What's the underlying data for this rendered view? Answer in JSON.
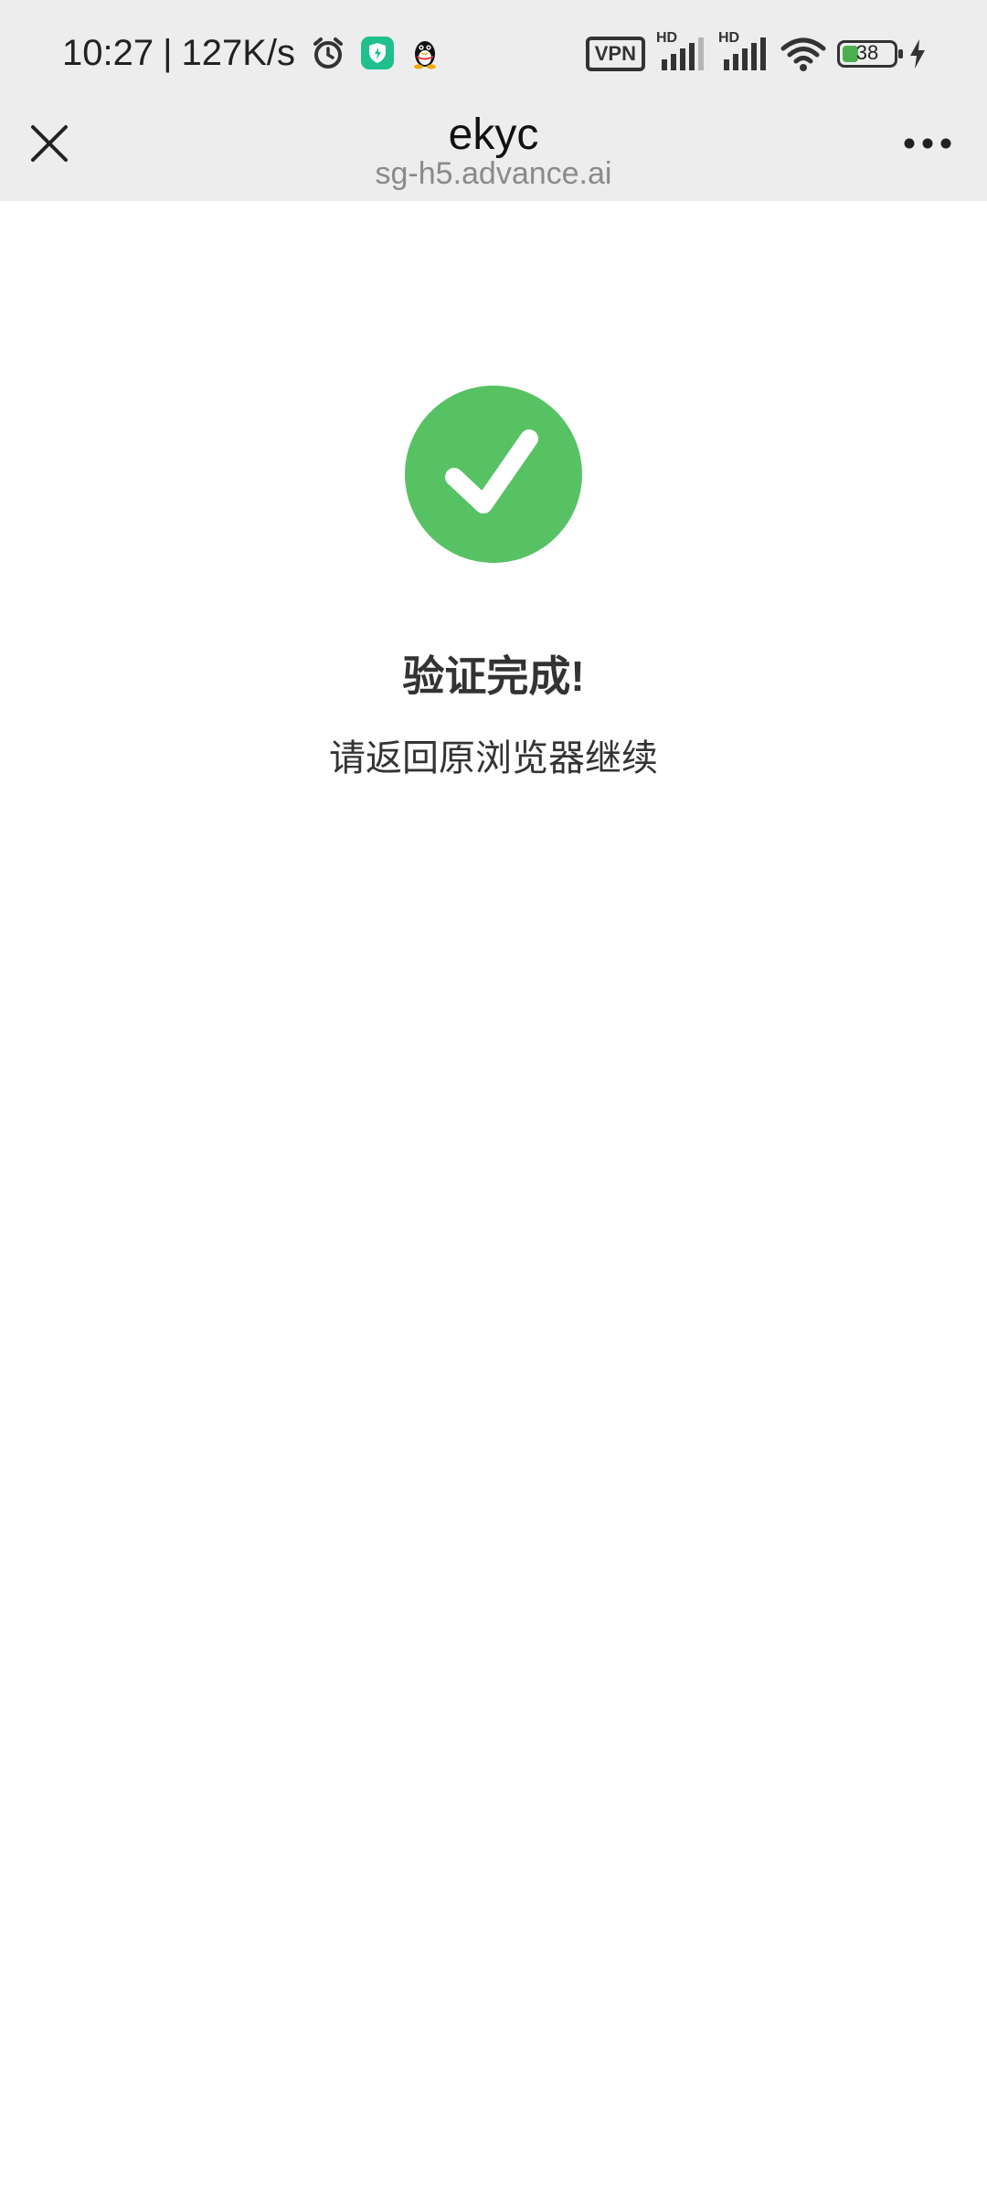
{
  "status_bar": {
    "time": "10:27",
    "separator": "|",
    "network_speed": "127K/s",
    "left_icons": [
      "alarm-icon",
      "security-shield-icon",
      "qq-penguin-icon"
    ],
    "vpn_label": "VPN",
    "signal_1_label": "HD",
    "signal_2_label": "HD",
    "battery_level": "38",
    "battery_fraction": 0.38,
    "charging": true,
    "accent_battery": "#4caf50"
  },
  "header": {
    "title": "ekyc",
    "subtitle": "sg-h5.advance.ai",
    "close_icon": "close-icon",
    "more_icon": "more-dots-icon"
  },
  "content": {
    "status_icon": "success-check-icon",
    "status_color": "#57c264",
    "headline": "验证完成!",
    "message": "请返回原浏览器继续"
  }
}
